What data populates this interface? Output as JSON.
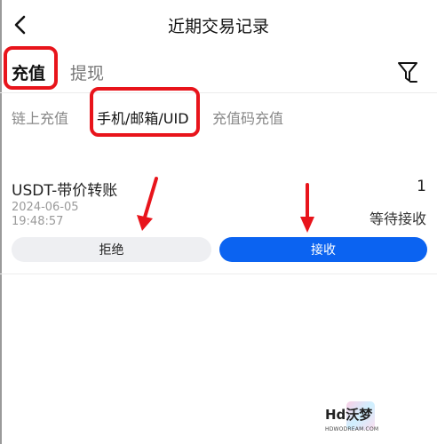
{
  "header": {
    "title": "近期交易记录",
    "back_icon": "chevron-left-icon"
  },
  "tabs": [
    {
      "label": "充值",
      "active": true
    },
    {
      "label": "提现",
      "active": false
    }
  ],
  "filter_icon": "filter-icon",
  "subtabs": [
    {
      "label": "链上充值",
      "active": false
    },
    {
      "label": "手机/邮箱/UID",
      "active": true
    },
    {
      "label": "充值码充值",
      "active": false
    }
  ],
  "record": {
    "type": "USDT-带价转账",
    "amount": "1",
    "date": "2024-06-05",
    "time": "19:48:57",
    "status": "等待接收",
    "reject_label": "拒绝",
    "accept_label": "接收"
  },
  "colors": {
    "accent": "#0b63f1",
    "highlight": "#e8141b",
    "reject_bg": "#eeeff2"
  },
  "watermark": {
    "logo": "Hd沃梦",
    "site": "HDWODREAM.COM"
  }
}
